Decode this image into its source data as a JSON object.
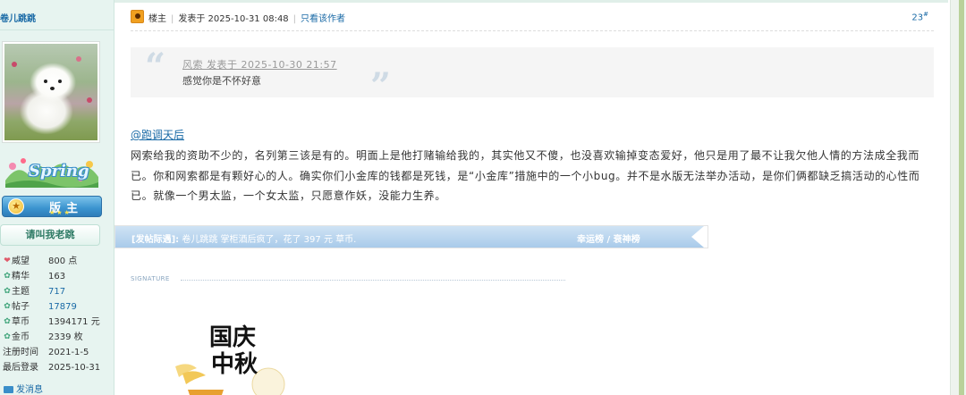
{
  "user": {
    "name": "卷儿跳跳",
    "spring_badge": "Spring",
    "moderator_badge": "版主",
    "call_button": "请叫我老跳",
    "stats": [
      {
        "icon": "heart-icon",
        "label": "威望",
        "value": "800 点",
        "link": false
      },
      {
        "icon": "leaf-icon",
        "label": "精华",
        "value": "163",
        "link": false
      },
      {
        "icon": "leaf-icon",
        "label": "主题",
        "value": "717",
        "link": true
      },
      {
        "icon": "leaf-icon",
        "label": "帖子",
        "value": "17879",
        "link": true
      },
      {
        "icon": "leaf-icon",
        "label": "草币",
        "value": "1394171 元",
        "link": false
      },
      {
        "icon": "leaf-icon",
        "label": "金币",
        "value": "2339 枚",
        "link": false
      },
      {
        "icon": "",
        "label": "注册时间",
        "value": "2021-1-5",
        "link": false
      },
      {
        "icon": "",
        "label": "最后登录",
        "value": "2025-10-31",
        "link": false
      }
    ],
    "pm_label": "发消息"
  },
  "post": {
    "owner_tag": "楼主",
    "posted_at": "发表于 2025-10-31 08:48",
    "only_author": "只看该作者",
    "floor": "23",
    "floor_mark": "#",
    "quote": {
      "author": "风索 发表于 2025-10-30 21:57",
      "text": "感觉你是不怀好意"
    },
    "mention": "@跑调天后",
    "body": "网索给我的资助不少的，名列第三该是有的。明面上是他打赌输给我的，其实他又不傻，也没喜欢输掉变态爱好，他只是用了最不让我欠他人情的方法成全我而已。你和网索都是有颗好心的人。确实你们小金库的钱都是死钱，是“小金库”措施中的一个小bug。并不是水版无法举办活动，是你们俩都缺乏搞活动的心性而已。就像一个男太监，一个女太监，只愿意作妖，没能力生养。",
    "reward": {
      "prefix": "[发帖际遇]:",
      "text": "卷儿跳跳 掌柜酒后疯了，花了 397 元 草币.",
      "links": "幸运榜 / 衰神榜"
    },
    "signature_label": "SIGNATURE",
    "signature_art_text": "国庆中秋"
  },
  "colors": {
    "accent_blue": "#1a6aa6",
    "sidebar_bg": "#e7f4f0",
    "reward_bar": "#a9cbea"
  }
}
